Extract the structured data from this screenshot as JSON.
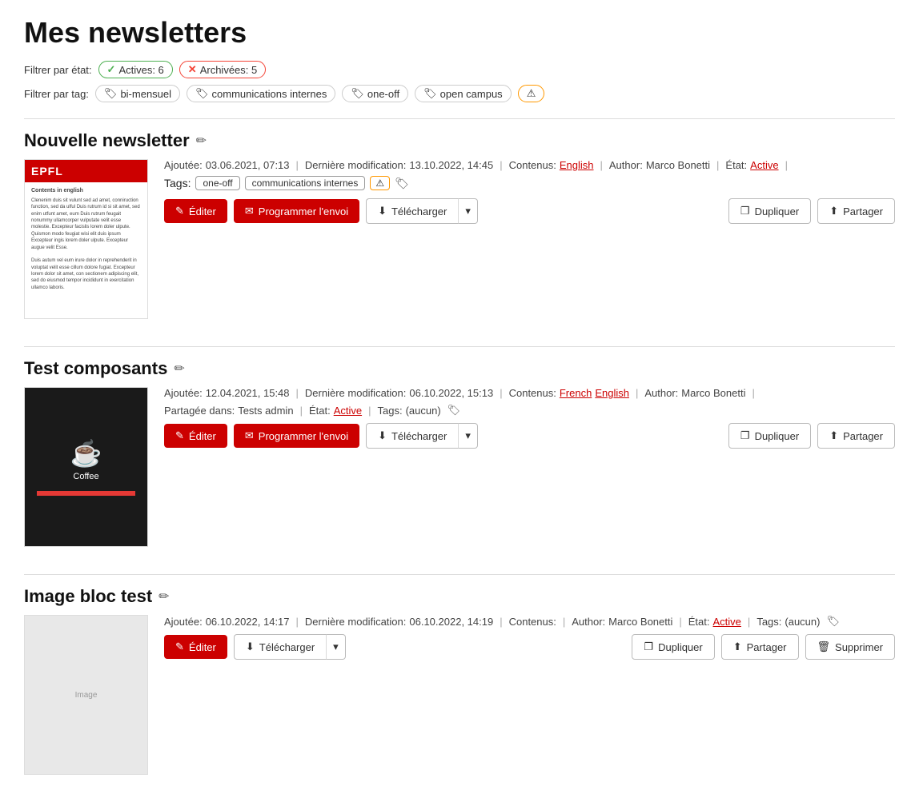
{
  "page": {
    "title": "Mes newsletters"
  },
  "filters": {
    "by_state_label": "Filtrer par état:",
    "by_tag_label": "Filtrer par tag:",
    "state_chips": [
      {
        "id": "active",
        "label": "Actives: 6",
        "type": "active"
      },
      {
        "id": "archived",
        "label": "Archivées: 5",
        "type": "archived"
      }
    ],
    "tag_chips": [
      {
        "id": "bi-mensuel",
        "label": "bi-mensuel"
      },
      {
        "id": "communications-internes",
        "label": "communications internes"
      },
      {
        "id": "one-off",
        "label": "one-off"
      },
      {
        "id": "open-campus",
        "label": "open campus"
      },
      {
        "id": "warning",
        "label": "⚠",
        "type": "warning"
      }
    ]
  },
  "newsletters": [
    {
      "id": "nouvelle-newsletter",
      "title": "Nouvelle newsletter",
      "added": "03.06.2021, 07:13",
      "last_modified": "13.10.2022, 14:45",
      "contenus_label": "Contenus:",
      "contenus": [
        "English"
      ],
      "author_label": "Author:",
      "author": "Marco Bonetti",
      "etat_label": "État:",
      "etat": "Active",
      "tags_label": "Tags:",
      "tags": [
        "one-off",
        "communications internes"
      ],
      "has_warning_tag": true,
      "buttons": {
        "edit": "Éditer",
        "schedule": "Programmer l'envoi",
        "download": "Télécharger",
        "duplicate": "Dupliquer",
        "share": "Partager"
      },
      "show_delete": false
    },
    {
      "id": "test-composants",
      "title": "Test composants",
      "added": "12.04.2021, 15:48",
      "last_modified": "06.10.2022, 15:13",
      "contenus_label": "Contenus:",
      "contenus": [
        "French",
        "English"
      ],
      "author_label": "Author:",
      "author": "Marco Bonetti",
      "etat_label": "État:",
      "etat": "Active",
      "shared_label": "Partagée dans:",
      "shared": "Tests admin",
      "tags_label": "Tags:",
      "tags_value": "(aucun)",
      "has_warning_tag": false,
      "buttons": {
        "edit": "Éditer",
        "schedule": "Programmer l'envoi",
        "download": "Télécharger",
        "duplicate": "Dupliquer",
        "share": "Partager"
      },
      "show_delete": false
    },
    {
      "id": "image-bloc-test",
      "title": "Image bloc test",
      "added": "06.10.2022, 14:17",
      "last_modified": "06.10.2022, 14:19",
      "contenus_label": "Contenus:",
      "contenus": [],
      "author_label": "Author:",
      "author": "Marco Bonetti",
      "etat_label": "État:",
      "etat": "Active",
      "tags_label": "Tags:",
      "tags_value": "(aucun)",
      "has_warning_tag": false,
      "buttons": {
        "edit": "Éditer",
        "download": "Télécharger",
        "duplicate": "Dupliquer",
        "share": "Partager",
        "delete": "Supprimer"
      },
      "show_delete": true
    }
  ],
  "icons": {
    "edit": "✎",
    "mail": "✉",
    "download": "⬇",
    "duplicate": "❐",
    "share": "⬆",
    "delete": "🗑",
    "chevron": "▾",
    "tag": "🏷",
    "pencil": "✏"
  }
}
